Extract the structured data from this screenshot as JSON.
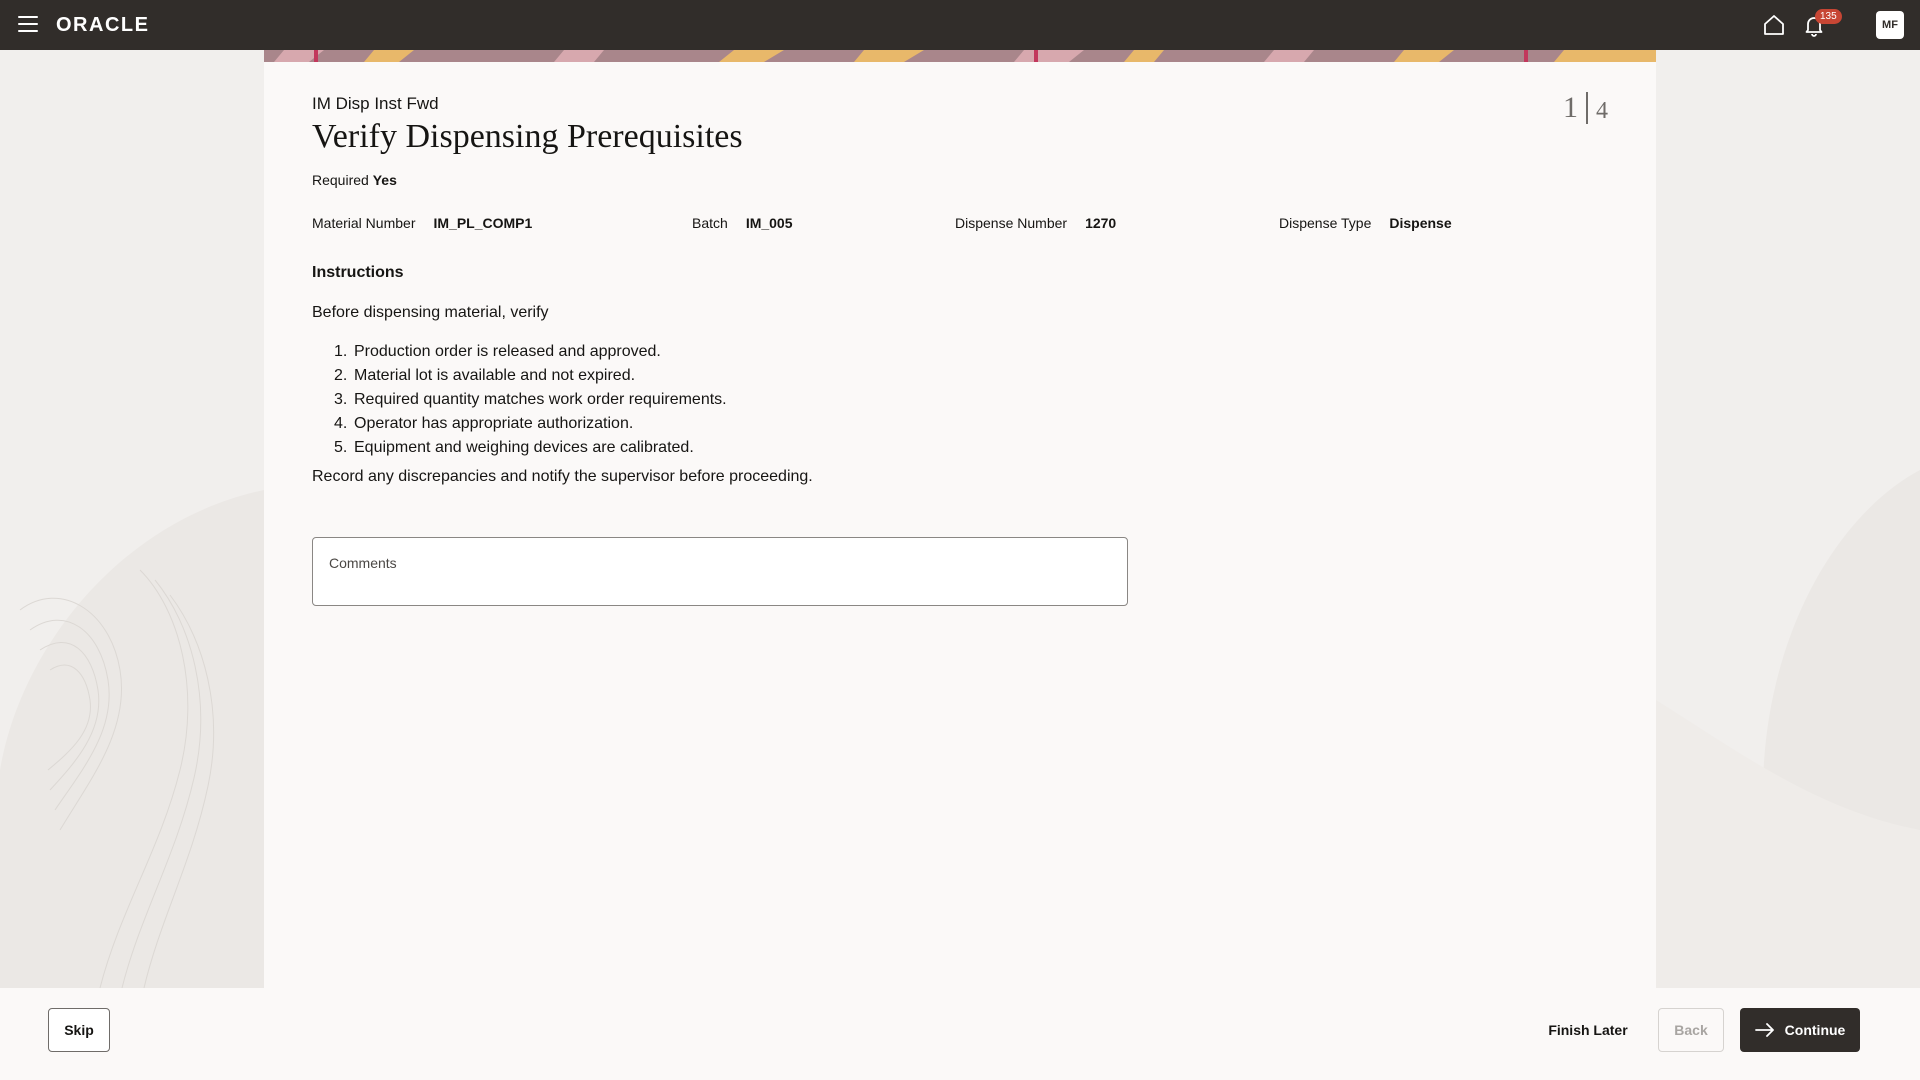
{
  "topbar": {
    "brand": "ORACLE",
    "notifications_count": "135",
    "user_initials": "MF"
  },
  "page": {
    "breadcrumb": "IM Disp Inst Fwd",
    "title": "Verify Dispensing Prerequisites",
    "step_current": "1",
    "step_total": "4",
    "required_label": "Required",
    "required_value": "Yes"
  },
  "details": {
    "material_number_label": "Material Number",
    "material_number_value": "IM_PL_COMP1",
    "batch_label": "Batch",
    "batch_value": "IM_005",
    "dispense_number_label": "Dispense Number",
    "dispense_number_value": "1270",
    "dispense_type_label": "Dispense Type",
    "dispense_type_value": "Dispense"
  },
  "instructions": {
    "heading": "Instructions",
    "intro": "Before dispensing material, verify",
    "items": [
      {
        "num": "1.",
        "text": "Production order is released and approved."
      },
      {
        "num": "2.",
        "text": "Material lot is available and not expired."
      },
      {
        "num": "3.",
        "text": "Required quantity matches work order requirements."
      },
      {
        "num": "4.",
        "text": "Operator has appropriate authorization."
      },
      {
        "num": "5.",
        "text": "Equipment and weighing devices are calibrated."
      }
    ],
    "outro": "Record any discrepancies and notify the supervisor before proceeding."
  },
  "comments": {
    "label": "Comments"
  },
  "footer": {
    "skip_label": "Skip",
    "finish_later_label": "Finish Later",
    "back_label": "Back",
    "continue_label": "Continue"
  },
  "colors": {
    "topbar": "#312d2a",
    "badge": "#c74634",
    "panel": "#fbf9f8",
    "page_bg": "#f1efed"
  }
}
